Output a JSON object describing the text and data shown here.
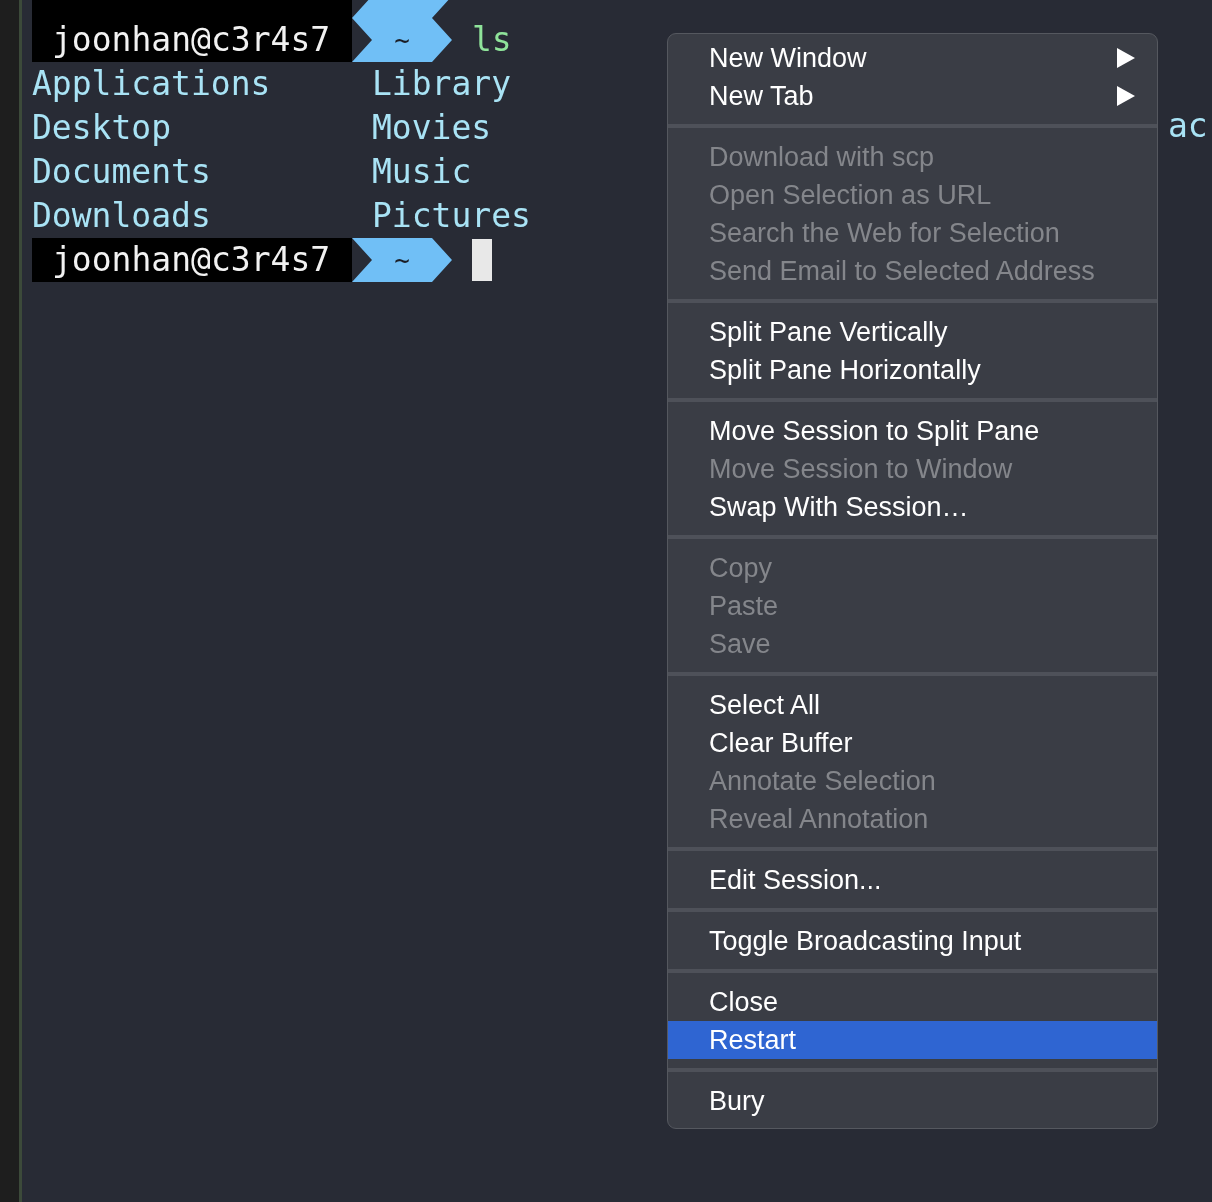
{
  "terminal": {
    "prompt": {
      "user": "joonhan@c3r4s7",
      "dir": "~",
      "command": "ls"
    },
    "listing": [
      [
        "Applications",
        "Library"
      ],
      [
        "Desktop",
        "Movies"
      ],
      [
        "Documents",
        "Music"
      ],
      [
        "Downloads",
        "Pictures"
      ]
    ],
    "last_prompt": {
      "user": "joonhan@c3r4s7",
      "dir": "~"
    },
    "background_text": "ac"
  },
  "context_menu": {
    "sections": [
      [
        {
          "label": "New Window",
          "disabled": false,
          "submenu": true,
          "selected": false
        },
        {
          "label": "New Tab",
          "disabled": false,
          "submenu": true,
          "selected": false
        }
      ],
      [
        {
          "label": "Download with scp",
          "disabled": true,
          "submenu": false,
          "selected": false
        },
        {
          "label": "Open Selection as URL",
          "disabled": true,
          "submenu": false,
          "selected": false
        },
        {
          "label": "Search the Web for Selection",
          "disabled": true,
          "submenu": false,
          "selected": false
        },
        {
          "label": "Send Email to Selected Address",
          "disabled": true,
          "submenu": false,
          "selected": false
        }
      ],
      [
        {
          "label": "Split Pane Vertically",
          "disabled": false,
          "submenu": false,
          "selected": false
        },
        {
          "label": "Split Pane Horizontally",
          "disabled": false,
          "submenu": false,
          "selected": false
        }
      ],
      [
        {
          "label": "Move Session to Split Pane",
          "disabled": false,
          "submenu": false,
          "selected": false
        },
        {
          "label": "Move Session to Window",
          "disabled": true,
          "submenu": false,
          "selected": false
        },
        {
          "label": "Swap With Session…",
          "disabled": false,
          "submenu": false,
          "selected": false
        }
      ],
      [
        {
          "label": "Copy",
          "disabled": true,
          "submenu": false,
          "selected": false
        },
        {
          "label": "Paste",
          "disabled": true,
          "submenu": false,
          "selected": false
        },
        {
          "label": "Save",
          "disabled": true,
          "submenu": false,
          "selected": false
        }
      ],
      [
        {
          "label": "Select All",
          "disabled": false,
          "submenu": false,
          "selected": false
        },
        {
          "label": "Clear Buffer",
          "disabled": false,
          "submenu": false,
          "selected": false
        },
        {
          "label": "Annotate Selection",
          "disabled": true,
          "submenu": false,
          "selected": false
        },
        {
          "label": "Reveal Annotation",
          "disabled": true,
          "submenu": false,
          "selected": false
        }
      ],
      [
        {
          "label": "Edit Session...",
          "disabled": false,
          "submenu": false,
          "selected": false
        }
      ],
      [
        {
          "label": "Toggle Broadcasting Input",
          "disabled": false,
          "submenu": false,
          "selected": false
        }
      ],
      [
        {
          "label": "Close",
          "disabled": false,
          "submenu": false,
          "selected": false
        },
        {
          "label": "Restart",
          "disabled": false,
          "submenu": false,
          "selected": true
        }
      ],
      [
        {
          "label": "Bury",
          "disabled": false,
          "submenu": false,
          "selected": false
        }
      ]
    ]
  }
}
